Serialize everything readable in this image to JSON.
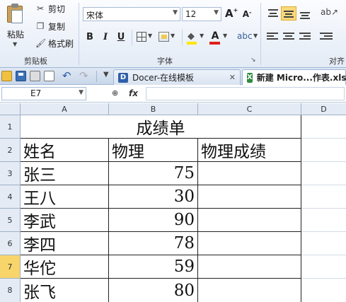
{
  "ribbon": {
    "clipboard": {
      "paste_label": "粘贴",
      "cut_label": "剪切",
      "copy_label": "复制",
      "format_painter_label": "格式刷",
      "group_label": "剪贴板"
    },
    "font": {
      "font_name": "宋体",
      "font_size": "12",
      "group_label": "字体",
      "bold": "B",
      "italic": "I",
      "underline": "U",
      "grow_label": "A",
      "shrink_label": "A",
      "font_color_label": "A"
    },
    "alignment": {
      "group_label": "对齐"
    }
  },
  "tabs": [
    {
      "label": "Docer-在线模板",
      "active": false
    },
    {
      "label": "新建 Micro...作表.xls",
      "active": true
    }
  ],
  "formula_bar": {
    "name_box": "E7",
    "fx_label": "fx",
    "content": ""
  },
  "columns": [
    "A",
    "B",
    "C",
    "D"
  ],
  "rows": [
    "1",
    "2",
    "3",
    "4",
    "5",
    "6",
    "7",
    "8"
  ],
  "selected_row": "7",
  "sheet": {
    "title": "成绩单",
    "headers": [
      "姓名",
      "物理",
      "物理成绩"
    ],
    "records": [
      {
        "name": "张三",
        "score": "75",
        "grade": ""
      },
      {
        "name": "王八",
        "score": "30",
        "grade": ""
      },
      {
        "name": "李武",
        "score": "90",
        "grade": ""
      },
      {
        "name": "李四",
        "score": "78",
        "grade": ""
      },
      {
        "name": "华佗",
        "score": "59",
        "grade": ""
      },
      {
        "name": "张飞",
        "score": "80",
        "grade": ""
      }
    ]
  },
  "colors": {
    "ribbon_bg": "#e3ebf6",
    "header_bg": "#e4ebf5",
    "selected_row_header": "#f7d56b",
    "font_color_red": "#e0201b",
    "highlight_yellow": "#ffe600"
  }
}
